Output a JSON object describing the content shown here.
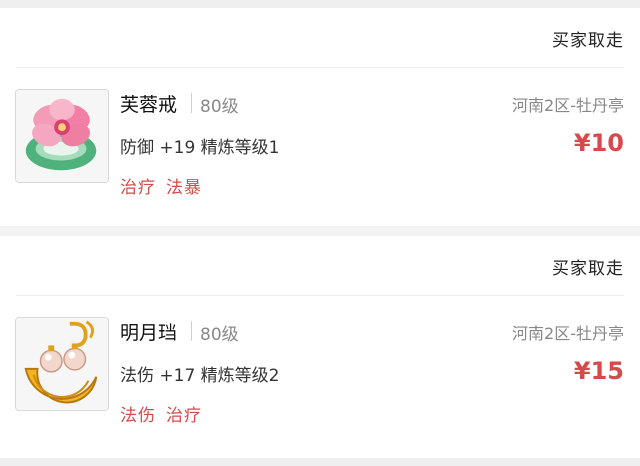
{
  "listings": [
    {
      "status": "买家取走",
      "name": "芙蓉戒",
      "level": "80级",
      "server": "河南2区-牡丹亭",
      "attr": "防御 +19 精炼等级1",
      "price": "¥10",
      "tags": [
        "治疗",
        "法暴"
      ],
      "icon": "lotus-jade-ring-icon"
    },
    {
      "status": "买家取走",
      "name": "明月珰",
      "level": "80级",
      "server": "河南2区-牡丹亭",
      "attr": "法伤 +17 精炼等级2",
      "price": "¥15",
      "tags": [
        "法伤",
        "治疗"
      ],
      "icon": "pearl-moon-earring-icon"
    }
  ],
  "colors": {
    "price": "#d54b4b",
    "tag": "#d54b4b",
    "muted": "#888888"
  }
}
